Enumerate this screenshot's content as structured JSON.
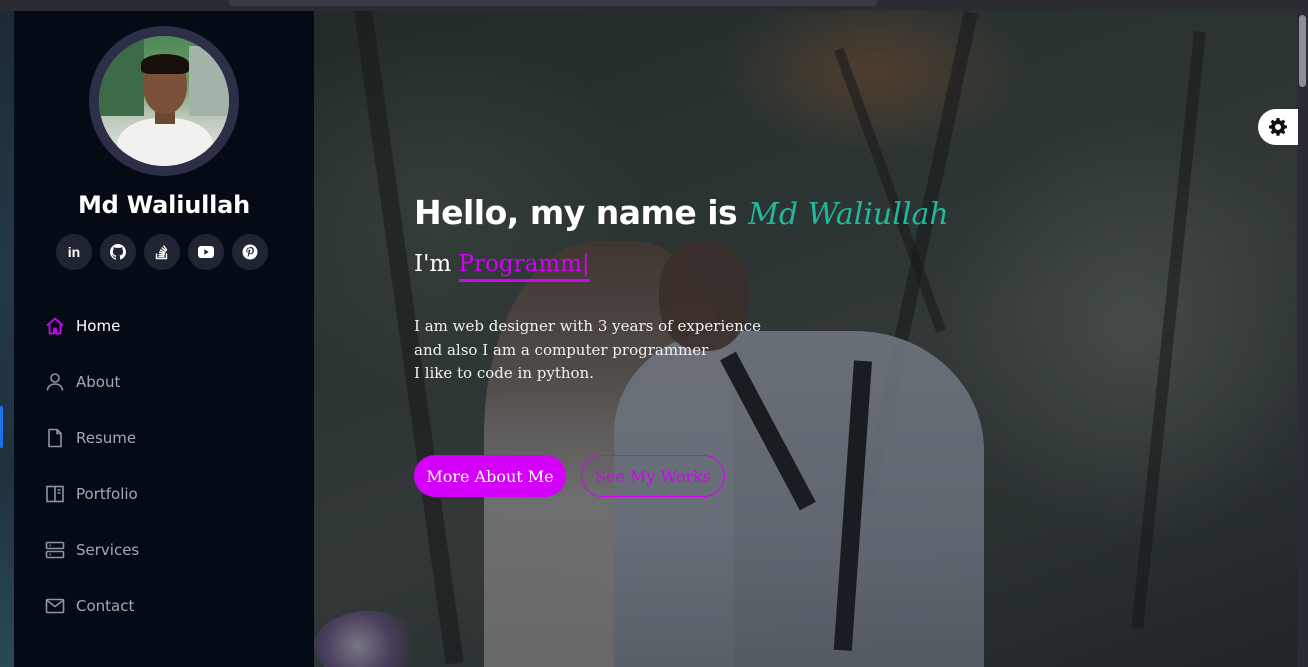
{
  "profile": {
    "name": "Md Waliullah"
  },
  "socials": [
    {
      "icon": "linkedin-icon",
      "label": "in"
    },
    {
      "icon": "github-icon"
    },
    {
      "icon": "stackoverflow-icon"
    },
    {
      "icon": "youtube-icon"
    },
    {
      "icon": "pinterest-icon"
    }
  ],
  "nav": {
    "items": [
      {
        "label": "Home",
        "icon": "home-icon",
        "active": true
      },
      {
        "label": "About",
        "icon": "user-icon",
        "active": false
      },
      {
        "label": "Resume",
        "icon": "file-icon",
        "active": false
      },
      {
        "label": "Portfolio",
        "icon": "book-icon",
        "active": false
      },
      {
        "label": "Services",
        "icon": "server-icon",
        "active": false
      },
      {
        "label": "Contact",
        "icon": "envelope-icon",
        "active": false
      }
    ]
  },
  "hero": {
    "greeting": "Hello, my name is ",
    "script_name": "Md Waliullah",
    "iam_prefix": "I'm ",
    "typed_text": "Programm|",
    "desc_lines": [
      "I am web designer with 3 years of experience",
      "and also I am a computer programmer",
      "I like to code in python."
    ],
    "primary_button": "More About Me",
    "secondary_button": "See My Works"
  },
  "colors": {
    "accent": "#d500f9",
    "script_name": "#22b89a",
    "sidebar_bg": "#040b14"
  }
}
